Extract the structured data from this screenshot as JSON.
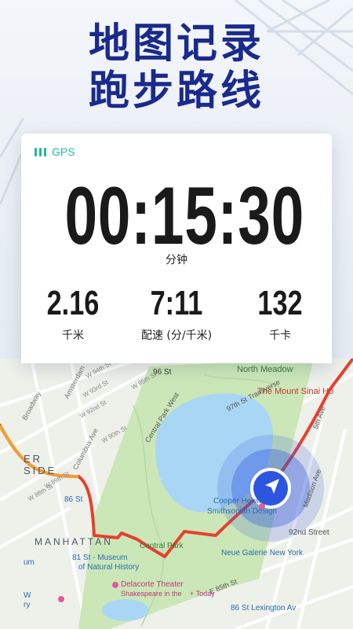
{
  "headline": {
    "line1": "地图记录",
    "line2": "跑步路线"
  },
  "card": {
    "gps_label": "GPS",
    "timer": "00:15:30",
    "timer_unit": "分钟",
    "stats": [
      {
        "value": "2.16",
        "label": "千米"
      },
      {
        "value": "7:11",
        "label": "配速 (分/千米)"
      },
      {
        "value": "132",
        "label": "千卡"
      }
    ]
  },
  "map": {
    "labels": {
      "north_meadow": "North Meadow",
      "mount_sinai": "The Mount Sinai Ho",
      "st96": "96 St",
      "street_97_transverse": "97th St Transverse",
      "central_park_west": "Central Park West",
      "amsterdam": "Amsterdam",
      "broadway": "Broadway",
      "columbus": "Columbus Ave",
      "w90": "W 90th St",
      "w88": "W 88th St",
      "w89": "W 89th St",
      "w93": "W 93rd St",
      "w95": "W 95th St",
      "w94": "W 94th St",
      "w92": "W 92nd St",
      "st86": "86 St",
      "manhattan": "MANHATTAN",
      "cooper_hewitt": "Cooper Hewitt",
      "smithsonian": "Smithsonian Design",
      "madison": "Madison Ave",
      "st92": "92nd Street",
      "central_park": "Central Park",
      "neue_galerie": "Neue Galerie New York",
      "museum1": "81 St - Museum",
      "museum2": "of Natural History",
      "delacorte": "Delacorte Theater",
      "shakespeare": "Shakespeare in the",
      "today": "+ Today",
      "e85": "E 85th St",
      "st86_lex": "86 St Lexington Av",
      "fifth_ave": "5th Ave",
      "um": "um",
      "w": "W",
      "ry": "ry",
      "er": "ER",
      "side": "SIDE"
    },
    "colors": {
      "route": "#e8402f",
      "route_start": "#f0a030",
      "park": "#cbe7b8",
      "water": "#a9d6f5",
      "locator": "#2e55e0"
    }
  }
}
